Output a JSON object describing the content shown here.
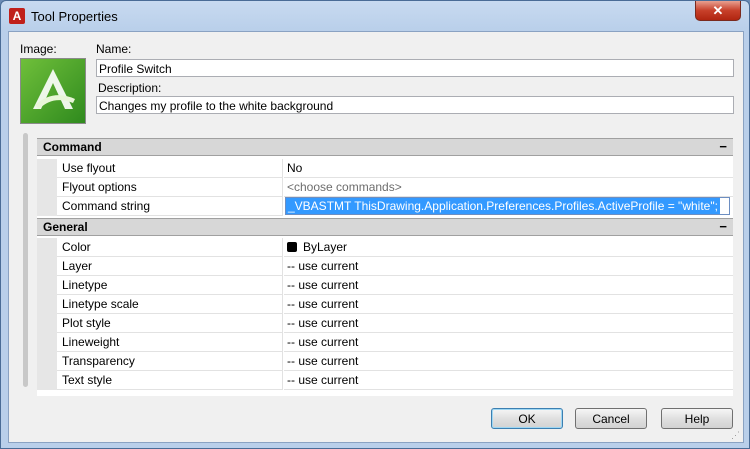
{
  "window": {
    "title": "Tool Properties",
    "close_glyph": "✕"
  },
  "app_icon": {
    "glyph": "A",
    "color": "#c0201a"
  },
  "image": {
    "label": "Image:"
  },
  "name": {
    "label": "Name:",
    "value": "Profile Switch"
  },
  "description": {
    "label": "Description:",
    "value": "Changes my profile to the white background"
  },
  "categories": [
    {
      "label": "Command",
      "toggle": "−"
    },
    {
      "label": "General",
      "toggle": "−"
    }
  ],
  "command_rows": [
    {
      "name": "Use flyout",
      "value": "No"
    },
    {
      "name": "Flyout options",
      "value": "<choose commands>"
    },
    {
      "name": "Command string",
      "value": "_VBASTMT ThisDrawing.Application.Preferences.Profiles.ActiveProfile = \"white\";"
    }
  ],
  "general_rows": [
    {
      "name": "Color",
      "value": "ByLayer"
    },
    {
      "name": "Layer",
      "value": "-- use current"
    },
    {
      "name": "Linetype",
      "value": "-- use current"
    },
    {
      "name": "Linetype scale",
      "value": "-- use current"
    },
    {
      "name": "Plot style",
      "value": "-- use current"
    },
    {
      "name": "Lineweight",
      "value": "-- use current"
    },
    {
      "name": "Transparency",
      "value": "-- use current"
    },
    {
      "name": "Text style",
      "value": "-- use current"
    }
  ],
  "buttons": {
    "ok": "OK",
    "cancel": "Cancel",
    "help": "Help"
  },
  "colors": {
    "selection": "#3399ff",
    "color_swatch": "#000000"
  }
}
